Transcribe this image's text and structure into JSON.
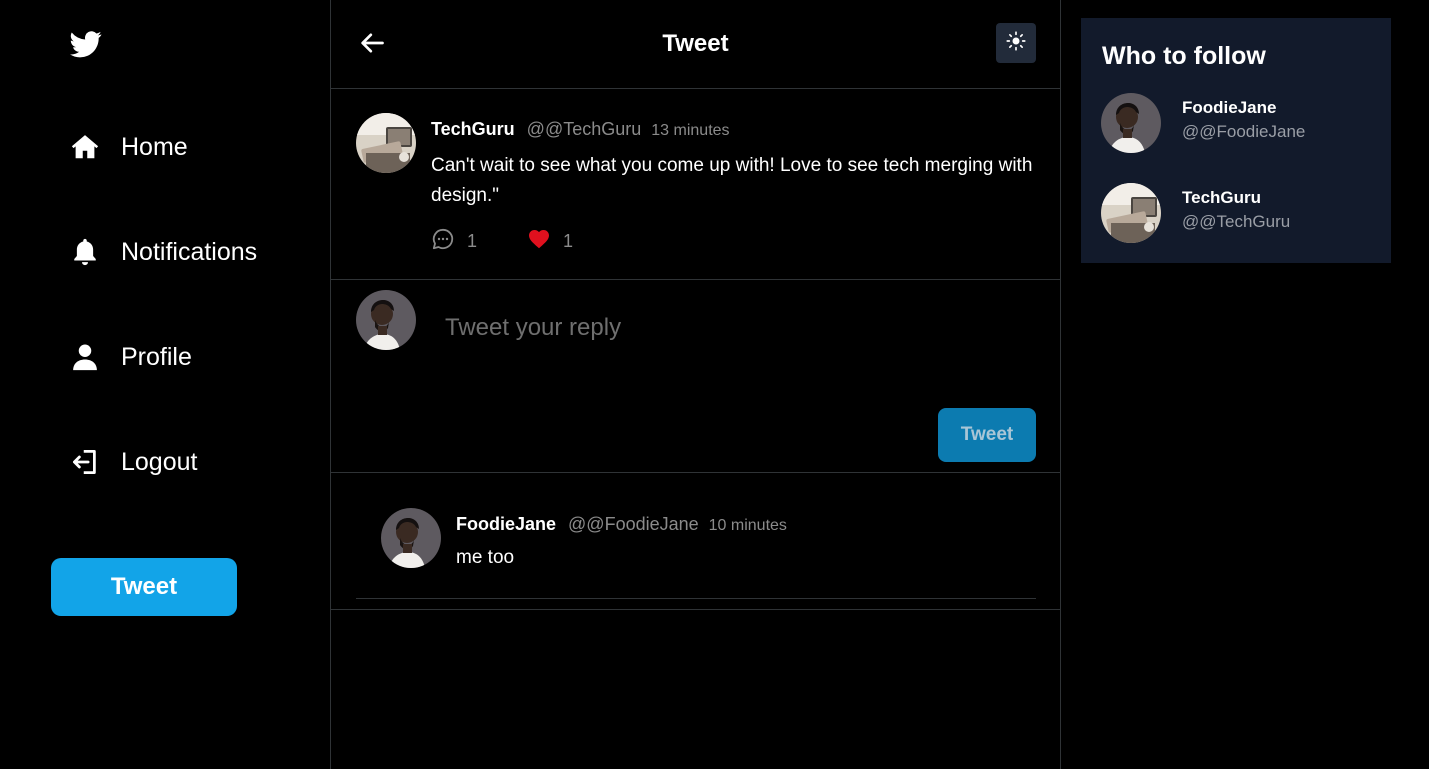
{
  "sidebar": {
    "logo": "twitter-bird-icon",
    "items": [
      {
        "label": "Home",
        "icon": "home-icon"
      },
      {
        "label": "Notifications",
        "icon": "bell-icon"
      },
      {
        "label": "Profile",
        "icon": "user-icon"
      },
      {
        "label": "Logout",
        "icon": "logout-icon"
      }
    ],
    "tweet_button": "Tweet"
  },
  "header": {
    "title": "Tweet",
    "back_icon": "arrow-left-icon",
    "theme_icon": "sun-icon"
  },
  "tweet": {
    "name": "TechGuru",
    "handle": "@@TechGuru",
    "time": "13 minutes",
    "text": "Can't wait to see what you come up with! Love to see tech merging with design.\"",
    "comments": "1",
    "likes": "1"
  },
  "reply_box": {
    "placeholder": "Tweet your reply",
    "value": "",
    "button": "Tweet"
  },
  "replies": [
    {
      "name": "FoodieJane",
      "handle": "@@FoodieJane",
      "time": "10 minutes",
      "text": "me too"
    }
  ],
  "who_to_follow": {
    "title": "Who to follow",
    "users": [
      {
        "name": "FoodieJane",
        "handle": "@@FoodieJane"
      },
      {
        "name": "TechGuru",
        "handle": "@@TechGuru"
      }
    ]
  },
  "colors": {
    "background": "#000000",
    "accent": "#12a4e8",
    "reply_button": "#0c7bb0",
    "like": "#e0101e",
    "panel": "#121a2b",
    "border": "#2f3336",
    "muted_text": "#8b8b8b"
  }
}
